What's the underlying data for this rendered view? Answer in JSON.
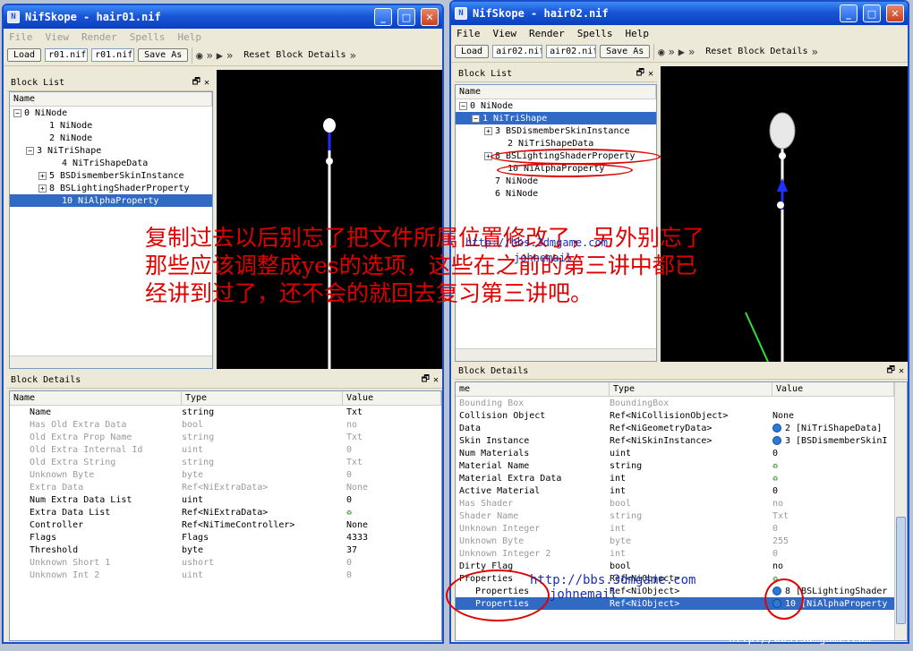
{
  "left": {
    "title": "NifSkope - hair01.nif",
    "menu": [
      "File",
      "View",
      "Render",
      "Spells",
      "Help"
    ],
    "toolbar": {
      "load": "Load",
      "field1": "r01.nif",
      "field2": "r01.nif",
      "save": "Save As",
      "reset": "Reset Block Details",
      "more": "»"
    },
    "block_list": {
      "title": "Block List",
      "col": "Name",
      "rows": [
        {
          "exp": "−",
          "label": "0 NiNode",
          "indent": 0
        },
        {
          "exp": "",
          "label": "1 NiNode",
          "indent": 2
        },
        {
          "exp": "",
          "label": "2 NiNode",
          "indent": 2
        },
        {
          "exp": "−",
          "label": "3 NiTriShape",
          "indent": 1
        },
        {
          "exp": "",
          "label": "4 NiTriShapeData",
          "indent": 3
        },
        {
          "exp": "+",
          "label": "5 BSDismemberSkinInstance",
          "indent": 2
        },
        {
          "exp": "+",
          "label": "8 BSLightingShaderProperty",
          "indent": 2
        },
        {
          "exp": "",
          "label": "10 NiAlphaProperty",
          "indent": 3,
          "sel": true
        }
      ]
    },
    "block_details": {
      "title": "Block Details",
      "cols": [
        "Name",
        "Type",
        "Value"
      ],
      "rows": [
        {
          "n": "Name",
          "t": "string",
          "v": "Txt",
          "dim": false
        },
        {
          "n": "Has Old Extra Data",
          "t": "bool",
          "v": "no",
          "dim": true
        },
        {
          "n": "Old Extra Prop Name",
          "t": "string",
          "v": "Txt",
          "dim": true
        },
        {
          "n": "Old Extra Internal Id",
          "t": "uint",
          "v": "0",
          "dim": true
        },
        {
          "n": "Old Extra String",
          "t": "string",
          "v": "Txt",
          "dim": true
        },
        {
          "n": "Unknown Byte",
          "t": "byte",
          "v": "0",
          "dim": true
        },
        {
          "n": "Extra Data",
          "t": "Ref<NiExtraData>",
          "v": "None",
          "dim": true
        },
        {
          "n": "Num Extra Data List",
          "t": "uint",
          "v": "0",
          "dim": false
        },
        {
          "n": "Extra Data List",
          "t": "Ref<NiExtraData>",
          "v": "♻",
          "dim": false
        },
        {
          "n": "Controller",
          "t": "Ref<NiTimeController>",
          "v": "None",
          "dim": false
        },
        {
          "n": "Flags",
          "t": "Flags",
          "v": "4333",
          "dim": false
        },
        {
          "n": "Threshold",
          "t": "byte",
          "v": "37",
          "dim": false
        },
        {
          "n": "Unknown Short 1",
          "t": "ushort",
          "v": "0",
          "dim": true
        },
        {
          "n": "Unknown Int 2",
          "t": "uint",
          "v": "0",
          "dim": true
        }
      ]
    }
  },
  "right": {
    "title": "NifSkope - hair02.nif",
    "menu": [
      "File",
      "View",
      "Render",
      "Spells",
      "Help"
    ],
    "toolbar": {
      "load": "Load",
      "field1": "air02.nif",
      "field2": "air02.nif",
      "save": "Save As",
      "reset": "Reset Block Details",
      "more": "»"
    },
    "block_list": {
      "title": "Block List",
      "col": "Name",
      "rows": [
        {
          "exp": "−",
          "label": "0 NiNode",
          "indent": 0
        },
        {
          "exp": "−",
          "label": "1 NiTriShape",
          "indent": 1,
          "sel": true
        },
        {
          "exp": "+",
          "label": "3 BSDismemberSkinInstance",
          "indent": 2
        },
        {
          "exp": "",
          "label": "2 NiTriShapeData",
          "indent": 3
        },
        {
          "exp": "+",
          "label": "8 BSLightingShaderProperty",
          "indent": 2
        },
        {
          "exp": "",
          "label": "10 NiAlphaProperty",
          "indent": 3
        },
        {
          "exp": "",
          "label": "7 NiNode",
          "indent": 2
        },
        {
          "exp": "",
          "label": "6 NiNode",
          "indent": 2
        }
      ]
    },
    "block_details": {
      "title": "Block Details",
      "cols": [
        "me",
        "Type",
        "Value"
      ],
      "rows": [
        {
          "n": "Bounding Box",
          "t": "BoundingBox",
          "v": "",
          "dim": true,
          "ind": 0
        },
        {
          "n": "Collision Object",
          "t": "Ref<NiCollisionObject>",
          "v": "None",
          "dim": false,
          "ind": 0
        },
        {
          "n": "Data",
          "t": "Ref<NiGeometryData>",
          "v": "2 [NiTriShapeData]",
          "dim": false,
          "ref": true,
          "ind": 0
        },
        {
          "n": "Skin Instance",
          "t": "Ref<NiSkinInstance>",
          "v": "3 [BSDismemberSkinI",
          "dim": false,
          "ref": true,
          "ind": 0
        },
        {
          "n": "Num Materials",
          "t": "uint",
          "v": "0",
          "dim": false,
          "ind": 0
        },
        {
          "n": "Material Name",
          "t": "string",
          "v": "♻",
          "dim": false,
          "ind": 0
        },
        {
          "n": "Material Extra Data",
          "t": "int",
          "v": "♻",
          "dim": false,
          "ind": 0
        },
        {
          "n": "Active Material",
          "t": "int",
          "v": "0",
          "dim": false,
          "ind": 0
        },
        {
          "n": "Has Shader",
          "t": "bool",
          "v": "no",
          "dim": true,
          "ind": 0
        },
        {
          "n": "Shader Name",
          "t": "string",
          "v": "Txt",
          "dim": true,
          "ind": 0
        },
        {
          "n": "Unknown Integer",
          "t": "int",
          "v": "0",
          "dim": true,
          "ind": 0
        },
        {
          "n": "Unknown Byte",
          "t": "byte",
          "v": "255",
          "dim": true,
          "ind": 0
        },
        {
          "n": "Unknown Integer 2",
          "t": "int",
          "v": "0",
          "dim": true,
          "ind": 0
        },
        {
          "n": "Dirty Flag",
          "t": "bool",
          "v": "no",
          "dim": false,
          "ind": 0
        },
        {
          "n": "Properties",
          "t": "Ref<NiObject>",
          "v": "♻",
          "dim": false,
          "ind": 0
        },
        {
          "n": "Properties",
          "t": "Ref<NiObject>",
          "v": "8 [BSLightingShader",
          "dim": false,
          "ref": true,
          "ind": 1
        },
        {
          "n": "Properties",
          "t": "Ref<NiObject>",
          "v": "10 [NiAlphaProperty",
          "dim": false,
          "ref": true,
          "ind": 1,
          "sel": true
        }
      ]
    }
  },
  "overlay": {
    "line1": "复制过去以后别忘了把文件所属位置修改了，另外别忘了",
    "line2": "那些应该调整成yes的选项，这些在之前的第三讲中都已",
    "line3": "经讲到过了，还不会的就回去复习第三讲吧。",
    "wm1": "http://bbs.3dmgame.com",
    "wm2": "johnemail",
    "wm3": "http://bbs.3dmgame.com",
    "wm4": "johnemail",
    "wm5": "http://bbs.3dmgame.com"
  },
  "colors": {
    "selection": "#316ac5",
    "annotation": "#e00000",
    "title": "#1956d6"
  }
}
